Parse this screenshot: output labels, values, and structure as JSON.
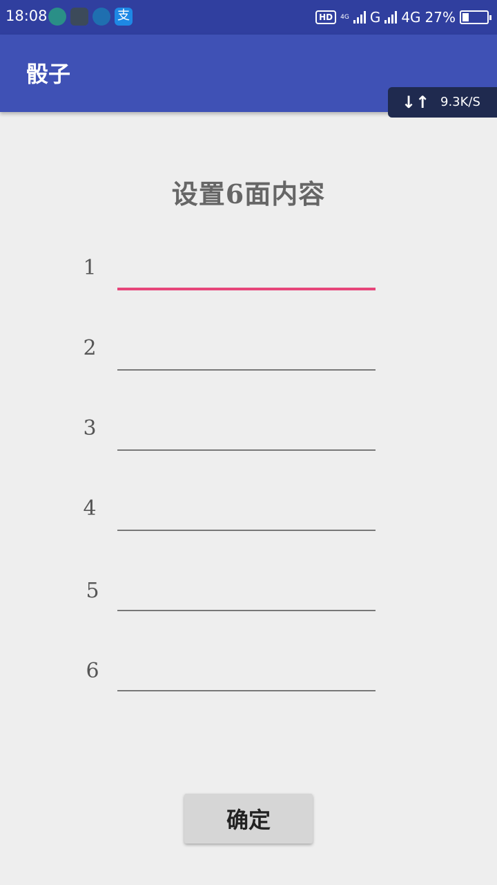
{
  "status_bar": {
    "time": "18:08",
    "hd_label": "HD",
    "network_small": "4G",
    "network_g": "G",
    "network_4g": "4G",
    "battery_percent": "27%",
    "battery_level": 0.27,
    "notification_icons": [
      "wechat-icon",
      "app-icon",
      "browser-icon",
      "alipay-icon"
    ],
    "alipay_glyph": "支"
  },
  "app_bar": {
    "title": "骰子",
    "background_color": "#3f51b5"
  },
  "speed_indicator": {
    "icon": "↓↑",
    "text": "9.3K/S"
  },
  "main": {
    "heading": "设置6面内容",
    "fields": [
      {
        "label": "1",
        "value": "",
        "focused": true
      },
      {
        "label": "2",
        "value": "",
        "focused": false
      },
      {
        "label": "3",
        "value": "",
        "focused": false
      },
      {
        "label": "4",
        "value": "",
        "focused": false
      },
      {
        "label": "5",
        "value": "",
        "focused": false
      },
      {
        "label": "6",
        "value": "",
        "focused": false
      }
    ],
    "confirm_label": "确定",
    "accent_color": "#e6457a"
  }
}
